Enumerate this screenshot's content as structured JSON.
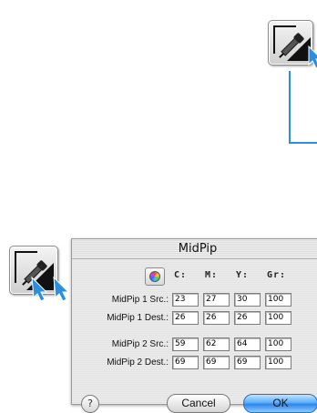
{
  "dialog": {
    "title": "MidPip",
    "columns": [
      "C:",
      "M:",
      "Y:",
      "Gr:"
    ],
    "rows": [
      {
        "label": "MidPip 1 Src.:",
        "values": [
          "23",
          "27",
          "30",
          "100"
        ]
      },
      {
        "label": "MidPip 1 Dest.:",
        "values": [
          "26",
          "26",
          "26",
          "100"
        ]
      },
      {
        "label": "MidPip 2 Src.:",
        "values": [
          "59",
          "62",
          "64",
          "100"
        ]
      },
      {
        "label": "MidPip 2 Dest.:",
        "values": [
          "69",
          "69",
          "69",
          "100"
        ]
      }
    ],
    "help_label": "?",
    "cancel_label": "Cancel",
    "ok_label": "OK"
  },
  "icons": {
    "tool_top": "midpip-eyedropper-tool-icon",
    "tool_left": "double-midpip-eyedropper-tool-icon",
    "color_picker": "color-wheel-icon",
    "pointer": "arrow-pointer-icon"
  },
  "colors": {
    "callout_line": "#2a8fe0",
    "ok_button": "#2e86e8"
  }
}
